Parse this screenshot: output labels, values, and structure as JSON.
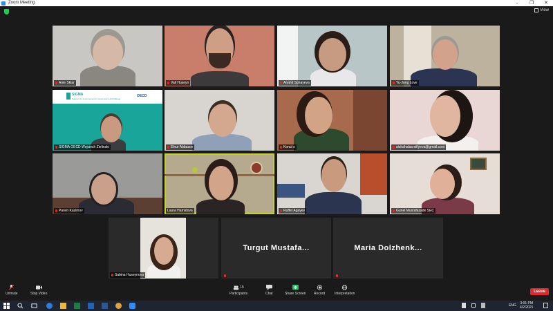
{
  "window": {
    "title": "Zoom Meeting",
    "min": "–",
    "max": "❐",
    "close": "✕"
  },
  "topbar": {
    "view_label": "View"
  },
  "tiles": [
    {
      "name": "Anie Sklar"
    },
    {
      "name": "Vali Huseyn"
    },
    {
      "name": "Anahit Sghayeva"
    },
    {
      "name": "Yu-Jong Love"
    },
    {
      "name": "SIGMA OECD Wojciech Zielinski",
      "slide_title": "SIGMA",
      "slide_sub": "Support for Improvement in Governance and Management",
      "slide_brand": "OECD"
    },
    {
      "name": "Elnur Abbasov"
    },
    {
      "name": "Konul s"
    },
    {
      "name": "aishahalasrxifiyeva@gmail.com"
    },
    {
      "name": "Parvin Kazimov"
    },
    {
      "name": "Laura Hamidova"
    },
    {
      "name": "Ruffet Agayev"
    },
    {
      "name": "Gunel Mustafazade SEC"
    },
    {
      "name": "Sabina Huseynova"
    },
    {
      "name": "Turgut Mustafa..."
    },
    {
      "name": "Maria Dolzhenk..."
    }
  ],
  "controls": {
    "unmute": "Unmute",
    "stop_video": "Stop Video",
    "participants": "Participants",
    "participants_count": "15",
    "chat": "Chat",
    "share_screen": "Share Screen",
    "record": "Record",
    "interpretation": "Interpretation",
    "leave": "Leave"
  },
  "taskbar": {
    "lang": "ENG",
    "time": "3:01 PM",
    "date": "4/2/2021"
  },
  "colors": {
    "share_green": "#23c55e",
    "leave_red": "#e02828",
    "active_border": "#c5d320",
    "taskbar": "#1f2530"
  }
}
